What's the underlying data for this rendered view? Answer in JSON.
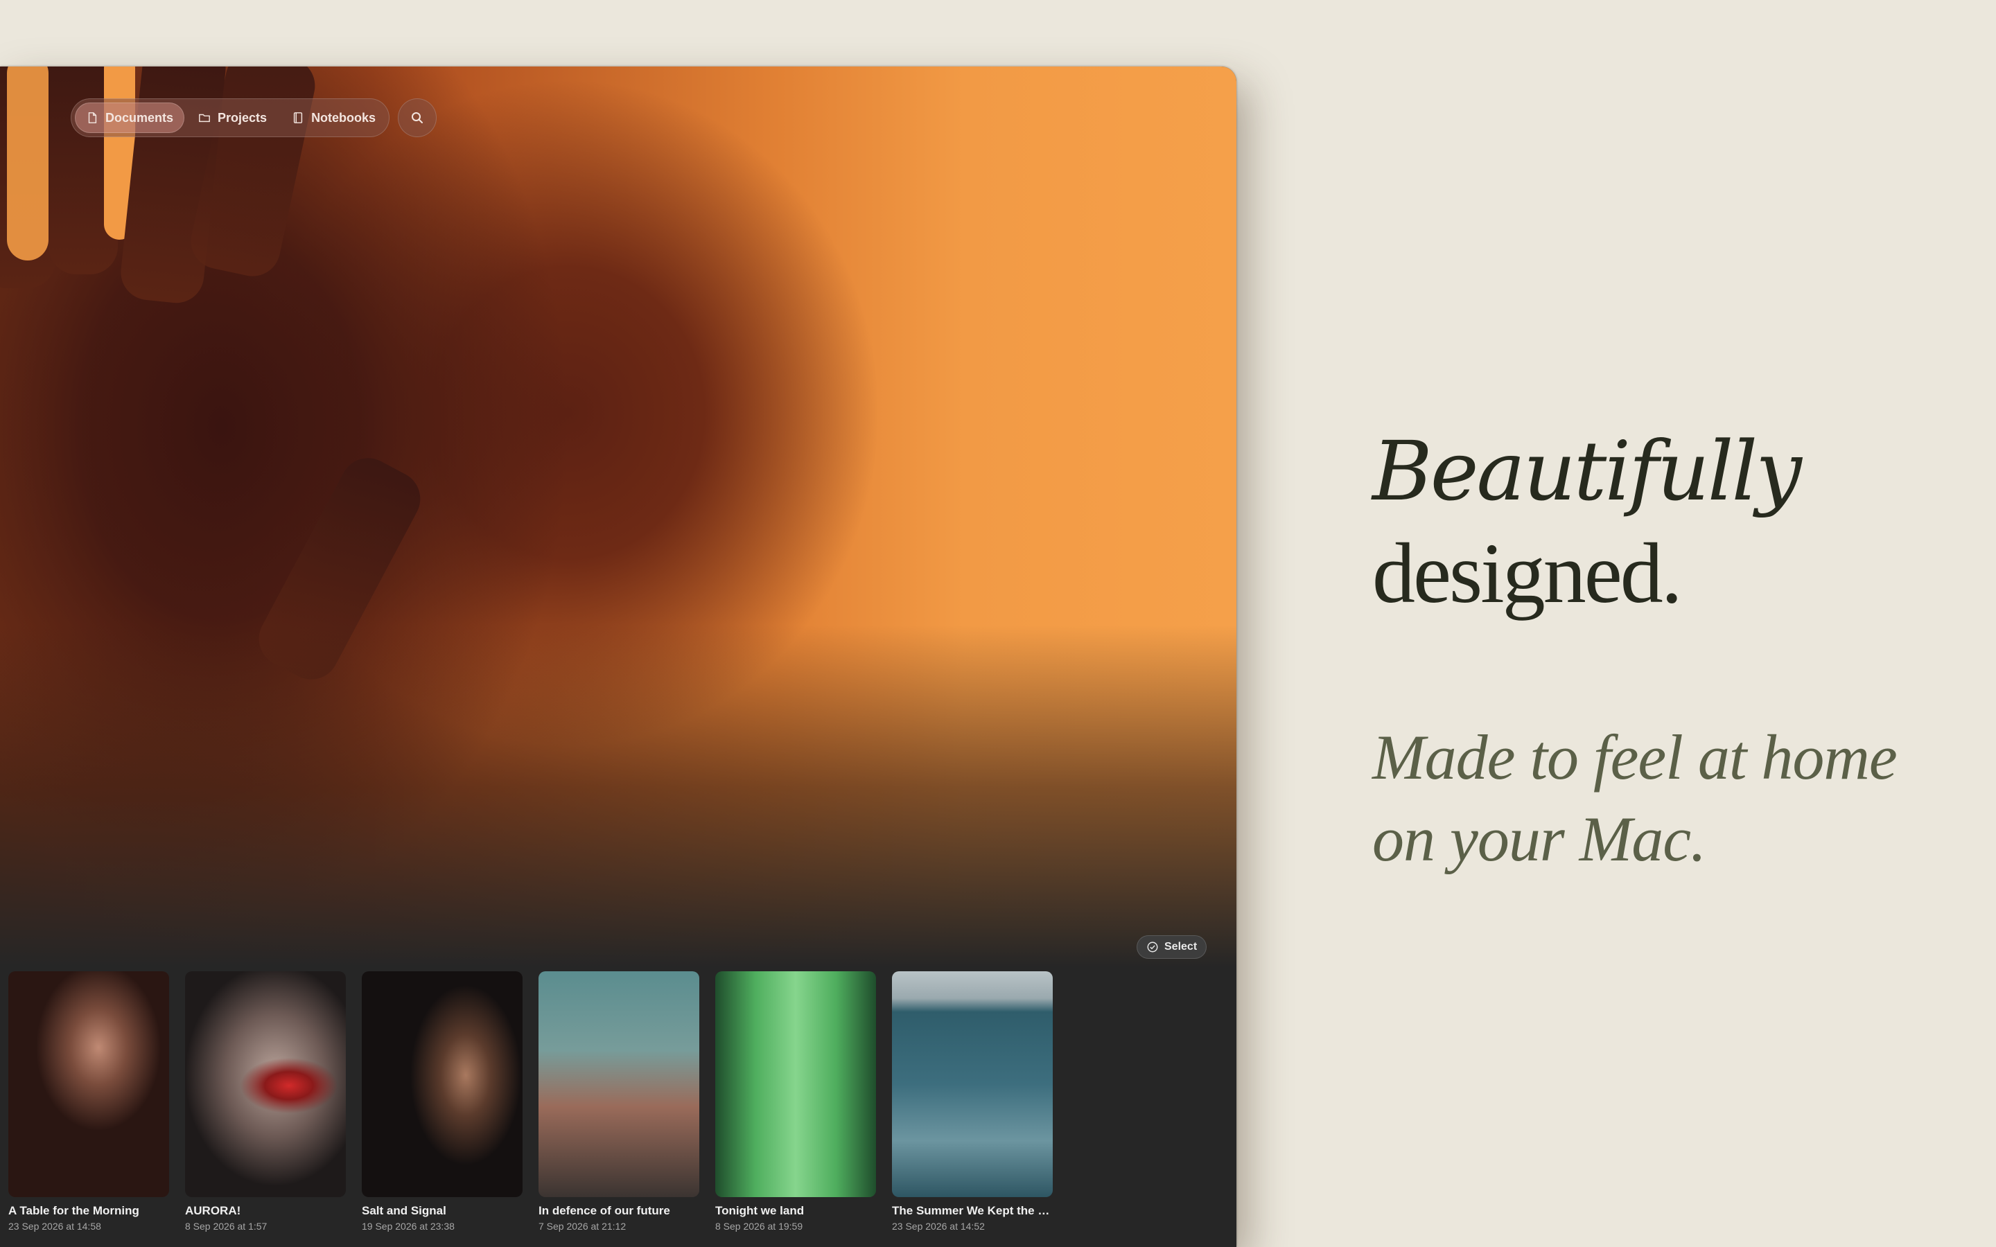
{
  "toolbar": {
    "tabs": [
      {
        "label": "Documents",
        "icon": "document-icon",
        "active": true
      },
      {
        "label": "Projects",
        "icon": "folder-icon",
        "active": false
      },
      {
        "label": "Notebooks",
        "icon": "notebook-icon",
        "active": false
      }
    ],
    "search_icon": "search-icon"
  },
  "select_button": {
    "label": "Select",
    "icon": "checkmark-circle-icon"
  },
  "documents": [
    {
      "title": "A Table for the Morning",
      "date": "23 Sep 2026 at 14:58"
    },
    {
      "title": "AURORA!",
      "date": "8 Sep 2026 at 1:57"
    },
    {
      "title": "Salt and Signal",
      "date": "19 Sep 2026 at 23:38"
    },
    {
      "title": "In defence of our future",
      "date": "7 Sep 2026 at 21:12"
    },
    {
      "title": "Tonight we land",
      "date": "8 Sep 2026 at 19:59"
    },
    {
      "title": "The Summer We Kept the C...",
      "date": "23 Sep 2026 at 14:52"
    }
  ],
  "marketing": {
    "headline_line1": "Beautifully",
    "headline_line2": "designed.",
    "subline_line1": "Made to feel at home",
    "subline_line2": "on your Mac."
  },
  "colors": {
    "page_background": "#ebe7dc",
    "window_background": "#262626",
    "headline": "#272a1e",
    "subline": "#5b6048",
    "hero_orange": "#f29a45"
  }
}
